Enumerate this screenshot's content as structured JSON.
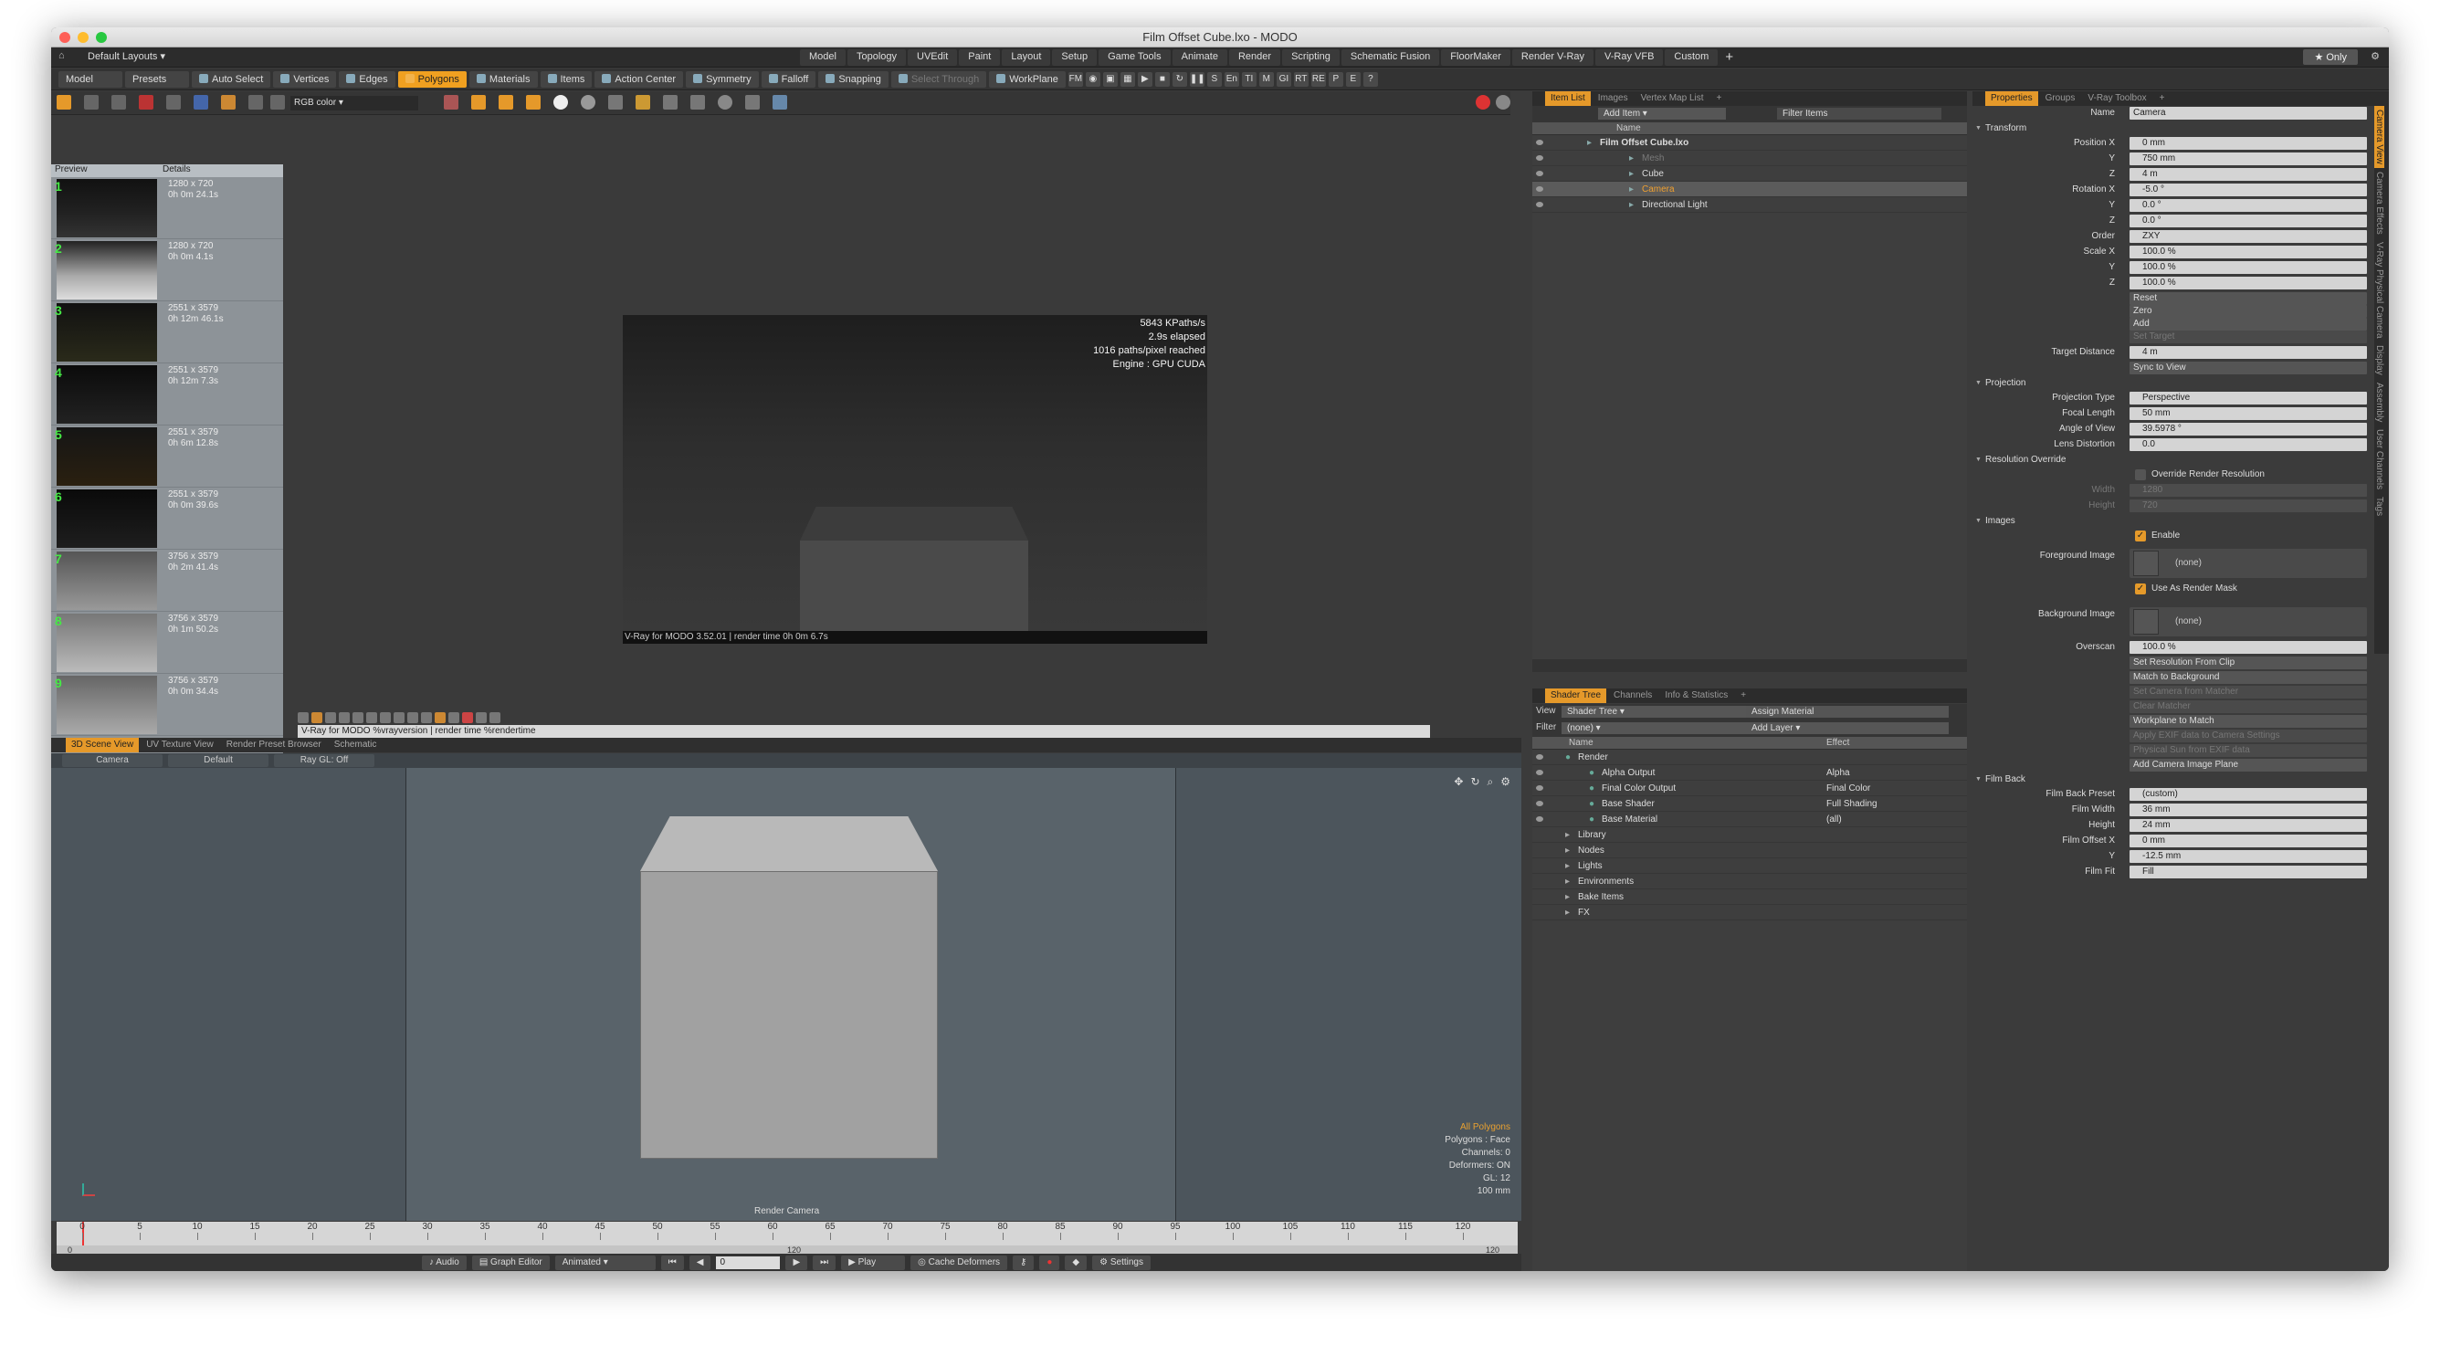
{
  "window": {
    "title": "Film Offset Cube.lxo - MODO"
  },
  "layoutbar": {
    "layout_dropdown": "Default Layouts",
    "tabs": [
      "Model",
      "Topology",
      "UVEdit",
      "Paint",
      "Layout",
      "Setup",
      "Game Tools",
      "Animate",
      "Render",
      "Scripting",
      "Schematic Fusion",
      "FloorMaker",
      "Render V-Ray",
      "V-Ray VFB",
      "Custom",
      "+"
    ],
    "only_label": "Only"
  },
  "toolbar": {
    "model": "Model",
    "presets": "Presets",
    "auto_select": "Auto Select",
    "vertices": "Vertices",
    "edges": "Edges",
    "polygons": "Polygons",
    "materials": "Materials",
    "items": "Items",
    "action_center": "Action Center",
    "symmetry": "Symmetry",
    "falloff": "Falloff",
    "snapping": "Snapping",
    "select_through": "Select Through",
    "workplane": "WorkPlane",
    "extra": [
      "FM",
      "S",
      "En",
      "TI",
      "M",
      "GI",
      "RT",
      "RE",
      "P",
      "E"
    ]
  },
  "render_panel": {
    "color_select": "RGB color",
    "history_headers": [
      "Preview",
      "Details"
    ],
    "history": [
      {
        "num": "1",
        "res": "1280 x 720",
        "time": "0h 0m 24.1s"
      },
      {
        "num": "2",
        "res": "1280 x 720",
        "time": "0h 0m 4.1s"
      },
      {
        "num": "3",
        "res": "2551 x 3579",
        "time": "0h 12m 46.1s"
      },
      {
        "num": "4",
        "res": "2551 x 3579",
        "time": "0h 12m 7.3s"
      },
      {
        "num": "5",
        "res": "2551 x 3579",
        "time": "0h 6m 12.8s"
      },
      {
        "num": "6",
        "res": "2551 x 3579",
        "time": "0h 0m 39.6s"
      },
      {
        "num": "7",
        "res": "3756 x 3579",
        "time": "0h 2m 41.4s"
      },
      {
        "num": "8",
        "res": "3756 x 3579",
        "time": "0h 1m 50.2s"
      },
      {
        "num": "9",
        "res": "3756 x 3579",
        "time": "0h 0m 34.4s"
      }
    ],
    "stats": [
      "5843 KPaths/s",
      "2.9s elapsed",
      "1016 paths/pixel reached",
      "Engine : GPU CUDA"
    ],
    "footer": "V-Ray for MODO 3.52.01 | render time 0h 0m 6.7s",
    "status": "V-Ray for MODO %vrayversion | render time %rendertime"
  },
  "view3d": {
    "tabs": [
      "3D Scene View",
      "UV Texture View",
      "Render Preset Browser",
      "Schematic"
    ],
    "sub": [
      "Camera",
      "Default",
      "Ray GL: Off"
    ],
    "render_camera": "Render Camera",
    "info": [
      "All Polygons",
      "Polygons : Face",
      "Channels: 0",
      "Deformers: ON",
      "GL: 12",
      "100 mm"
    ]
  },
  "timeline": {
    "ticks": [
      "0",
      "5",
      "10",
      "15",
      "20",
      "25",
      "30",
      "35",
      "40",
      "45",
      "50",
      "55",
      "60",
      "65",
      "70",
      "75",
      "80",
      "85",
      "90",
      "95",
      "100",
      "105",
      "110",
      "115",
      "120"
    ],
    "start": "0",
    "mid": "120",
    "end": "120"
  },
  "transport": {
    "audio": "Audio",
    "graph_editor": "Graph Editor",
    "animated": "Animated",
    "frame": "0",
    "play": "Play",
    "cache_deformers": "Cache Deformers",
    "settings": "Settings"
  },
  "itemlist": {
    "tabs": [
      "Item List",
      "Images",
      "Vertex Map List",
      "+"
    ],
    "add_item": "Add Item",
    "filter_items": "Filter Items",
    "col_name": "Name",
    "rows": [
      {
        "name": "Film Offset Cube.lxo",
        "indent": 74,
        "bold": true
      },
      {
        "name": "Mesh",
        "indent": 120,
        "dim": true
      },
      {
        "name": "Cube",
        "indent": 120
      },
      {
        "name": "Camera",
        "indent": 120,
        "sel": true
      },
      {
        "name": "Directional Light",
        "indent": 120
      }
    ]
  },
  "shadertree": {
    "tabs": [
      "Shader Tree",
      "Channels",
      "Info & Statistics",
      "+"
    ],
    "view_label": "View",
    "view_value": "Shader Tree",
    "assign_material": "Assign Material",
    "filter_label": "Filter",
    "filter_value": "(none)",
    "add_layer": "Add Layer",
    "col_name": "Name",
    "col_effect": "Effect",
    "rows": [
      {
        "name": "Render",
        "effect": "",
        "indent": 50
      },
      {
        "name": "Alpha Output",
        "effect": "Alpha",
        "indent": 76
      },
      {
        "name": "Final Color Output",
        "effect": "Final Color",
        "indent": 76
      },
      {
        "name": "Base Shader",
        "effect": "Full Shading",
        "indent": 76
      },
      {
        "name": "Base Material",
        "effect": "(all)",
        "indent": 76
      },
      {
        "name": "Library",
        "effect": "",
        "indent": 50
      },
      {
        "name": "Nodes",
        "effect": "",
        "indent": 50
      },
      {
        "name": "Lights",
        "effect": "",
        "indent": 50
      },
      {
        "name": "Environments",
        "effect": "",
        "indent": 50
      },
      {
        "name": "Bake Items",
        "effect": "",
        "indent": 50
      },
      {
        "name": "FX",
        "effect": "",
        "indent": 50
      }
    ]
  },
  "properties": {
    "tabs": [
      "Properties",
      "Groups",
      "V-Ray Toolbox",
      "+"
    ],
    "side_tabs": [
      "Camera View",
      "Camera Effects",
      "V-Ray Physical Camera",
      "Display",
      "Assembly",
      "User Channels",
      "Tags"
    ],
    "name_label": "Name",
    "name_value": "Camera",
    "sections": {
      "transform": "Transform",
      "projection": "Projection",
      "resolution": "Resolution Override",
      "images": "Images",
      "filmback": "Film Back"
    },
    "transform": [
      {
        "label": "Position X",
        "value": "0 mm"
      },
      {
        "label": "Y",
        "value": "750 mm"
      },
      {
        "label": "Z",
        "value": "4 m"
      },
      {
        "label": "Rotation X",
        "value": "-5.0 °"
      },
      {
        "label": "Y",
        "value": "0.0 °"
      },
      {
        "label": "Z",
        "value": "0.0 °"
      },
      {
        "label": "Order",
        "value": "ZXY"
      },
      {
        "label": "Scale X",
        "value": "100.0 %"
      },
      {
        "label": "Y",
        "value": "100.0 %"
      },
      {
        "label": "Z",
        "value": "100.0 %"
      }
    ],
    "transform_buttons": [
      "Reset",
      "Zero",
      "Add"
    ],
    "set_target": "Set Target",
    "target_distance_label": "Target Distance",
    "target_distance": "4 m",
    "sync_to_view": "Sync to View",
    "projection": [
      {
        "label": "Projection Type",
        "value": "Perspective"
      },
      {
        "label": "Focal Length",
        "value": "50 mm"
      },
      {
        "label": "Angle of View",
        "value": "39.5978 °"
      },
      {
        "label": "Lens Distortion",
        "value": "0.0"
      }
    ],
    "override_label": "Override Render Resolution",
    "width_label": "Width",
    "width_value": "1280",
    "height_label": "Height",
    "height_value": "720",
    "enable_label": "Enable",
    "foreground_label": "Foreground Image",
    "foreground_value": "(none)",
    "render_mask_label": "Use As Render Mask",
    "background_label": "Background Image",
    "background_value": "(none)",
    "overscan_label": "Overscan",
    "overscan_value": "100.0 %",
    "buttons": [
      "Set Resolution From Clip",
      "Match to Background",
      "Set Camera from Matcher",
      "Clear Matcher",
      "Workplane to Match",
      "Apply EXIF data to Camera Settings",
      "Physical Sun from EXIF data",
      "Add Camera Image Plane"
    ],
    "disabled_buttons": [
      false,
      false,
      true,
      true,
      false,
      true,
      true,
      false
    ],
    "filmback": [
      {
        "label": "Film Back Preset",
        "value": "(custom)"
      },
      {
        "label": "Film Width",
        "value": "36 mm"
      },
      {
        "label": "Height",
        "value": "24 mm"
      },
      {
        "label": "Film Offset X",
        "value": "0 mm"
      },
      {
        "label": "Y",
        "value": "-12.5 mm"
      },
      {
        "label": "Film Fit",
        "value": "Fill"
      }
    ]
  },
  "colors": {
    "accent": "#e5992a",
    "panel": "#3b3b3b",
    "viewport": "#59636a"
  }
}
